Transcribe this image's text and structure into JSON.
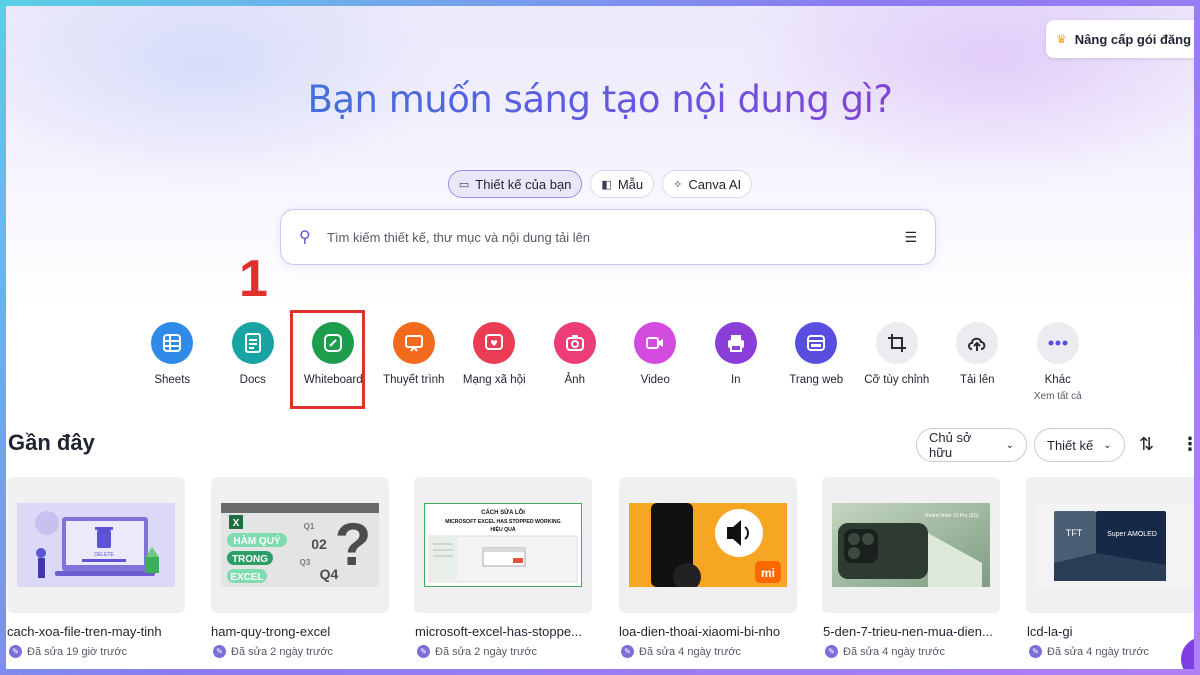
{
  "upgrade": {
    "label": "Nâng cấp gói đăng"
  },
  "headline": "Bạn muốn sáng tạo nội dung gì?",
  "tabs": [
    {
      "label": "Thiết kế của bạn",
      "icon": "folder-icon",
      "active": true
    },
    {
      "label": "Mẫu",
      "icon": "template-icon",
      "active": false
    },
    {
      "label": "Canva AI",
      "icon": "sparkle-icon",
      "active": false
    }
  ],
  "search": {
    "placeholder": "Tìm kiếm thiết kế, thư mục và nội dung tải lên"
  },
  "annotation": {
    "step": "1"
  },
  "categories": [
    {
      "label": "Sheets",
      "icon": "grid-icon",
      "color": "#2f8ae8"
    },
    {
      "label": "Docs",
      "icon": "doc-icon",
      "color": "#1aa3a3"
    },
    {
      "label": "Whiteboard",
      "icon": "whiteboard-icon",
      "color": "#1e9e4c"
    },
    {
      "label": "Thuyết trình",
      "icon": "presentation-icon",
      "color": "#f26a1b"
    },
    {
      "label": "Mạng xã hội",
      "icon": "heart-icon",
      "color": "#ea3c54"
    },
    {
      "label": "Ảnh",
      "icon": "camera-icon",
      "color": "#ec3d78"
    },
    {
      "label": "Video",
      "icon": "video-icon",
      "color": "#d44be0"
    },
    {
      "label": "In",
      "icon": "printer-icon",
      "color": "#8b3fd9"
    },
    {
      "label": "Trang web",
      "icon": "web-icon",
      "color": "#5a4ee0"
    },
    {
      "label": "Cỡ tùy chỉnh",
      "icon": "crop-icon",
      "color": "#ececf0"
    },
    {
      "label": "Tải lên",
      "icon": "upload-cloud-icon",
      "color": "#ececf0"
    },
    {
      "label": "Khác",
      "sub": "Xem tất cả",
      "icon": "more-icon",
      "color": "#ececf0"
    }
  ],
  "recent": {
    "title": "Gần đây",
    "owner_filter": "Chủ sở hữu",
    "type_filter": "Thiết kế",
    "files": [
      {
        "name": "cach-xoa-file-tren-may-tinh",
        "meta": "Đã sửa 19 giờ trước"
      },
      {
        "name": "ham-quy-trong-excel",
        "meta": "Đã sửa 2 ngày trước"
      },
      {
        "name": "microsoft-excel-has-stoppe...",
        "meta": "Đã sửa 2 ngày trước"
      },
      {
        "name": "loa-dien-thoai-xiaomi-bi-nho",
        "meta": "Đã sửa 4 ngày trước"
      },
      {
        "name": "5-den-7-trieu-nen-mua-dien...",
        "meta": "Đã sửa 4 ngày trước"
      },
      {
        "name": "lcd-la-gi",
        "meta": "Đã sửa 4 ngày trước"
      }
    ],
    "thumb_text": {
      "delete": "DELETE",
      "hq1": "HÀM QUÝ",
      "hq2": "TRONG",
      "hq3": "EXCEL",
      "hqa": "02",
      "hqb": "Q4",
      "hqc": "Q1",
      "hqd": "Q3",
      "excel_title": "CÁCH SỬA LỖI",
      "excel_sub": "MICROSOFT EXCEL HAS STOPPED WORKING",
      "excel_sub2": "HIỆU QUẢ",
      "mi": "mi",
      "redmi": "Redmi Note 13 Pro (5G)",
      "tft": "TFT",
      "amoled": "Super AMOLED"
    }
  }
}
